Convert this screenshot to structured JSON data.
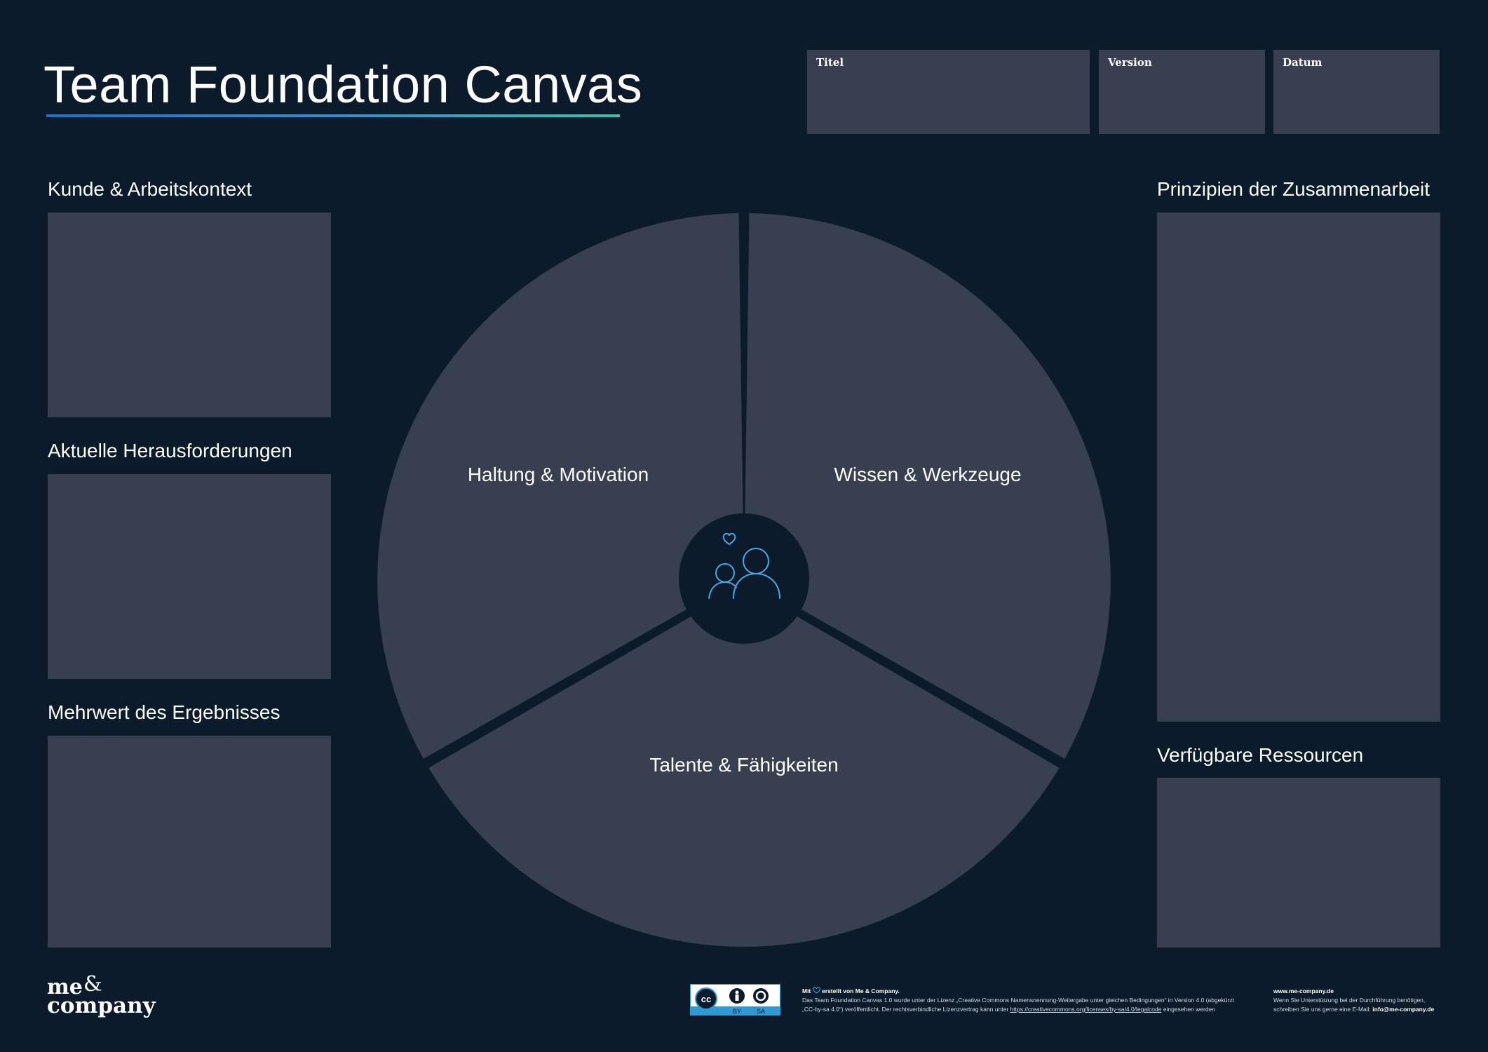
{
  "header": {
    "title": "Team Foundation Canvas",
    "fields": [
      {
        "label": "Titel"
      },
      {
        "label": "Version"
      },
      {
        "label": "Datum"
      }
    ]
  },
  "left_sections": [
    {
      "label": "Kunde & Arbeitskontext"
    },
    {
      "label": "Aktuelle Herausforderungen"
    },
    {
      "label": "Mehrwert des Ergebnisses"
    }
  ],
  "right_sections": [
    {
      "label": "Prinzipien der Zusammenarbeit"
    },
    {
      "label": "Verfügbare Ressourcen"
    }
  ],
  "circle": {
    "segments": [
      {
        "label": "Haltung & Motivation"
      },
      {
        "label": "Wissen & Werkzeuge"
      },
      {
        "label": "Talente & Fähigkeiten"
      }
    ],
    "center_icon": "team-heart-icon"
  },
  "footer": {
    "logo_line1": "me",
    "logo_amp": "&",
    "logo_line2": "company",
    "license_badge": {
      "cc": "cc",
      "by": "BY",
      "sa": "SA"
    },
    "credit_pre": "Mit",
    "credit_post": "erstellt von Me & Company.",
    "license_line1": "Das Team Foundation Canvas 1.0 wurde unter der Lizenz „Creative Commons Namensnennung-Weitergabe unter gleichen Bedingungen“ in Version 4.0 (abgekürzt",
    "license_line2_pre": "„CC-by-sa 4.0“) veröffentlicht. Der rechtsverbindliche Lizenzvertrag kann unter ",
    "license_link": "https://creativecommons.org/licenses/by-sa/4.0/legalcode",
    "license_line2_post": " eingesehen werden",
    "website": "www.me-company.de",
    "support_line1": "Wenn Sie Unterstützung bei der Durchführung benötigen,",
    "support_line2_pre": "schreiben Sie uns gerne eine E-Mail: ",
    "email": "info@me-company.de"
  },
  "colors": {
    "background": "#0b1b2b",
    "panel": "#383f50",
    "accent_blue": "#2b9bd6",
    "accent_teal": "#36c3a6",
    "icon_blue": "#4aa8e0"
  }
}
